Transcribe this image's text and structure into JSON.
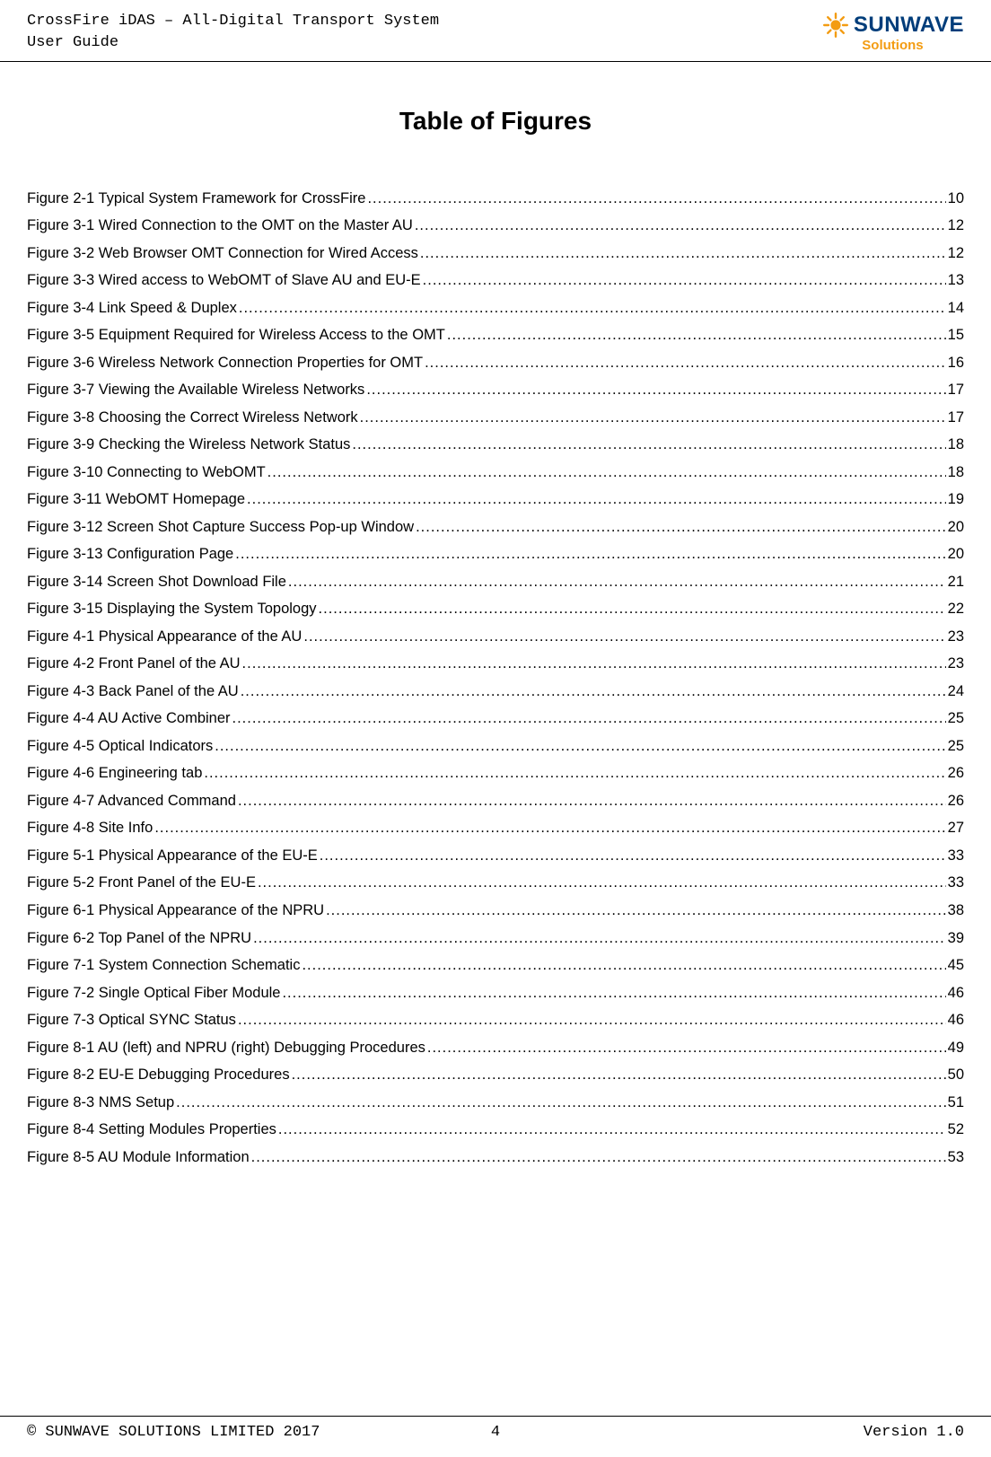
{
  "header": {
    "product_line": "CrossFire iDAS – All-Digital Transport System",
    "doc_type": "User Guide",
    "logo": {
      "brand": "SUNWAVE",
      "sub": "Solutions"
    }
  },
  "title": "Table of Figures",
  "entries": [
    {
      "label": "Figure 2-1 Typical System Framework for CrossFire",
      "page": "10"
    },
    {
      "label": "Figure 3-1 Wired Connection to the OMT on the Master AU",
      "page": "12"
    },
    {
      "label": "Figure 3-2 Web Browser OMT Connection for Wired Access",
      "page": "12"
    },
    {
      "label": "Figure 3-3 Wired access to WebOMT of Slave AU and EU-E",
      "page": "13"
    },
    {
      "label": "Figure 3-4 Link Speed & Duplex",
      "page": "14"
    },
    {
      "label": "Figure 3-5 Equipment Required for Wireless Access to the OMT",
      "page": "15"
    },
    {
      "label": "Figure 3-6 Wireless Network Connection Properties for OMT",
      "page": "16"
    },
    {
      "label": "Figure 3-7 Viewing the Available Wireless Networks",
      "page": "17"
    },
    {
      "label": "Figure 3-8 Choosing the Correct Wireless Network",
      "page": "17"
    },
    {
      "label": "Figure 3-9 Checking the Wireless Network Status",
      "page": "18"
    },
    {
      "label": "Figure 3-10 Connecting to WebOMT",
      "page": "18"
    },
    {
      "label": "Figure 3-11 WebOMT Homepage",
      "page": "19"
    },
    {
      "label": "Figure 3-12 Screen Shot Capture Success Pop-up Window",
      "page": "20"
    },
    {
      "label": "Figure 3-13 Configuration Page",
      "page": "20"
    },
    {
      "label": "Figure 3-14 Screen Shot Download File",
      "page": "21"
    },
    {
      "label": "Figure 3-15 Displaying the System Topology",
      "page": "22"
    },
    {
      "label": "Figure 4-1 Physical Appearance of the AU",
      "page": "23"
    },
    {
      "label": "Figure 4-2 Front Panel of the AU",
      "page": "23"
    },
    {
      "label": "Figure 4-3 Back Panel of the AU",
      "page": "24"
    },
    {
      "label": "Figure 4-4 AU Active Combiner",
      "page": "25"
    },
    {
      "label": "Figure 4-5 Optical Indicators",
      "page": "25"
    },
    {
      "label": "Figure 4-6 Engineering tab",
      "page": "26"
    },
    {
      "label": "Figure 4-7 Advanced Command",
      "page": "26"
    },
    {
      "label": "Figure 4-8 Site Info",
      "page": "27"
    },
    {
      "label": "Figure 5-1 Physical Appearance of the EU-E",
      "page": "33"
    },
    {
      "label": "Figure 5-2 Front Panel of the EU-E",
      "page": "33"
    },
    {
      "label": "Figure 6-1 Physical Appearance of the NPRU",
      "page": "38"
    },
    {
      "label": "Figure 6-2 Top Panel of the NPRU",
      "page": "39"
    },
    {
      "label": "Figure 7-1 System Connection Schematic",
      "page": "45"
    },
    {
      "label": "Figure 7-2 Single Optical Fiber Module",
      "page": "46"
    },
    {
      "label": "Figure 7-3 Optical SYNC Status",
      "page": "46"
    },
    {
      "label": "Figure 8-1 AU (left) and NPRU (right) Debugging Procedures",
      "page": "49"
    },
    {
      "label": "Figure 8-2 EU-E Debugging Procedures",
      "page": "50"
    },
    {
      "label": "Figure 8-3 NMS Setup",
      "page": "51"
    },
    {
      "label": "Figure 8-4 Setting Modules Properties",
      "page": "52"
    },
    {
      "label": "Figure 8-5 AU Module Information",
      "page": "53"
    }
  ],
  "footer": {
    "copyright": "© SUNWAVE SOLUTIONS LIMITED 2017",
    "page_number": "4",
    "version": "Version 1.0"
  }
}
